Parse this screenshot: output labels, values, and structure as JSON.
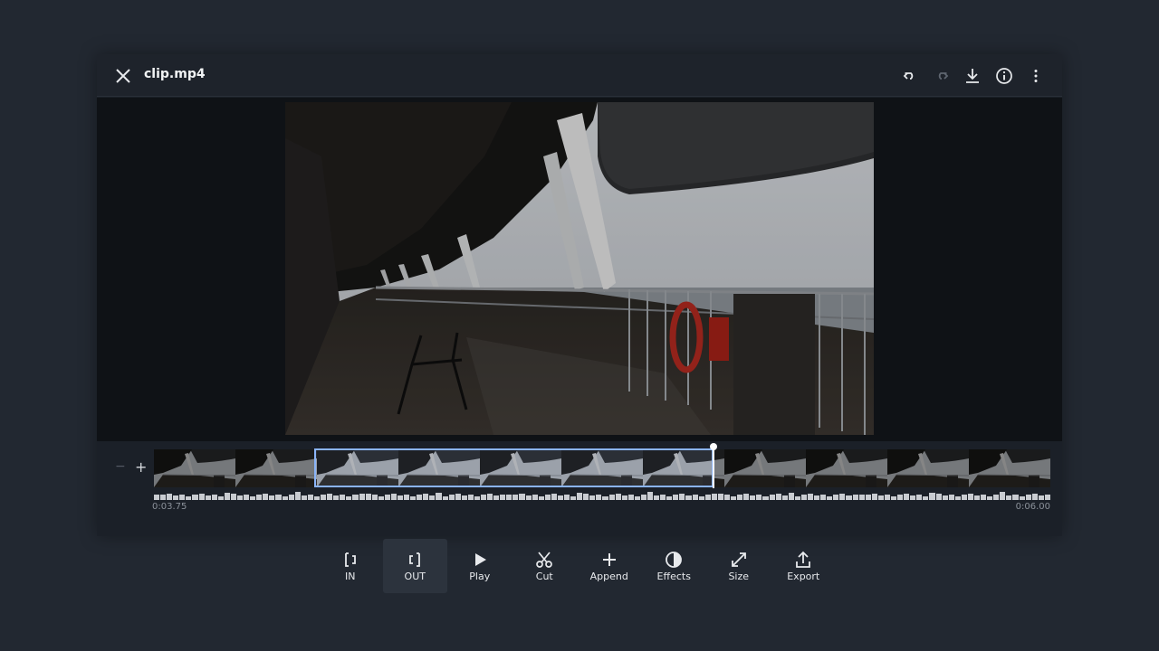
{
  "header": {
    "title": "clip.mp4",
    "icons": [
      "close-icon",
      "undo-icon",
      "redo-icon",
      "download-icon",
      "info-icon",
      "more-vert-icon"
    ]
  },
  "timeline": {
    "start_time": "0:03.75",
    "end_time": "0:06.00",
    "zoom_in_label": "+",
    "zoom_out_label": "−",
    "selection_start_fraction": 0.178,
    "selection_end_fraction": 0.625,
    "playhead_fraction": 0.625
  },
  "toolbar": {
    "tools": [
      {
        "label": "IN",
        "icon": "mark-in-icon",
        "active": false
      },
      {
        "label": "OUT",
        "icon": "mark-out-icon",
        "active": true
      },
      {
        "label": "Play",
        "icon": "play-icon",
        "active": false
      },
      {
        "label": "Cut",
        "icon": "scissors-icon",
        "active": false
      },
      {
        "label": "Append",
        "icon": "plus-icon",
        "active": false
      },
      {
        "label": "Effects",
        "icon": "contrast-icon",
        "active": false
      },
      {
        "label": "Size",
        "icon": "resize-icon",
        "active": false
      },
      {
        "label": "Export",
        "icon": "export-icon",
        "active": false
      }
    ]
  },
  "colors": {
    "accent": "#8ab4f8",
    "background": "#222831",
    "panel": "#1b2028"
  }
}
